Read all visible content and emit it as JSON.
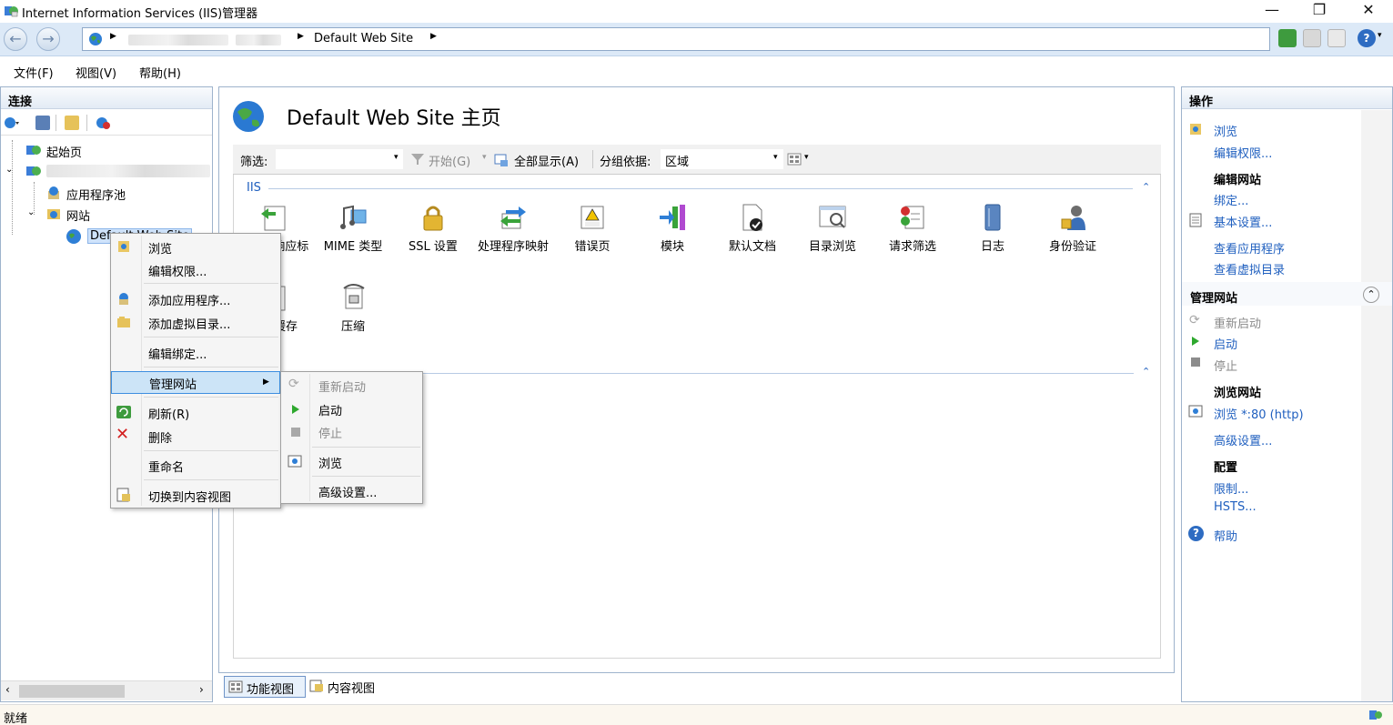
{
  "window": {
    "title": "Internet Information Services (IIS)管理器",
    "minimize": "—",
    "restore": "❐",
    "close": "✕"
  },
  "address": {
    "crumbs": [
      "Default Web Site"
    ]
  },
  "menubar": {
    "file": "文件(F)",
    "view": "视图(V)",
    "help": "帮助(H)"
  },
  "connections": {
    "title": "连接",
    "tree": {
      "start_page": "起始页",
      "app_pools": "应用程序池",
      "sites": "网站",
      "default_site": "Default Web Site"
    }
  },
  "center": {
    "heading": "Default Web Site 主页",
    "filter_label": "筛选:",
    "go_label": "开始(G)",
    "show_all_label": "全部显示(A)",
    "groupby_label": "分组依据:",
    "groupby_value": "区域",
    "group_name": "IIS",
    "features": [
      {
        "label": "HTTP 响应标头"
      },
      {
        "label": "MIME 类型"
      },
      {
        "label": "SSL 设置"
      },
      {
        "label": "处理程序映射"
      },
      {
        "label": "错误页"
      },
      {
        "label": "模块"
      },
      {
        "label": "默认文档"
      },
      {
        "label": "目录浏览"
      },
      {
        "label": "请求筛选"
      },
      {
        "label": "日志"
      },
      {
        "label": "身份验证"
      },
      {
        "label": "输出缓存"
      },
      {
        "label": "压缩"
      }
    ],
    "tabs": {
      "features_view": "功能视图",
      "content_view": "内容视图"
    }
  },
  "context_menu": {
    "items": {
      "browse": "浏览",
      "edit_permissions": "编辑权限...",
      "add_application": "添加应用程序...",
      "add_virtual_dir": "添加虚拟目录...",
      "edit_bindings": "编辑绑定...",
      "manage_website": "管理网站",
      "refresh": "刷新(R)",
      "delete": "删除",
      "rename": "重命名",
      "switch_content_view": "切换到内容视图"
    },
    "submenu": {
      "restart": "重新启动",
      "start": "启动",
      "stop": "停止",
      "browse": "浏览",
      "advanced": "高级设置..."
    }
  },
  "actions": {
    "title": "操作",
    "browse": "浏览",
    "edit_permissions": "编辑权限...",
    "edit_site_title": "编辑网站",
    "bindings": "绑定...",
    "basic_settings": "基本设置...",
    "view_apps": "查看应用程序",
    "view_vdirs": "查看虚拟目录",
    "manage_site_title": "管理网站",
    "restart": "重新启动",
    "start": "启动",
    "stop": "停止",
    "browse_site_title": "浏览网站",
    "browse_80": "浏览 *:80 (http)",
    "advanced_settings": "高级设置...",
    "config_title": "配置",
    "limits": "限制...",
    "hsts": "HSTS...",
    "help": "帮助"
  },
  "status": {
    "text": "就绪"
  }
}
